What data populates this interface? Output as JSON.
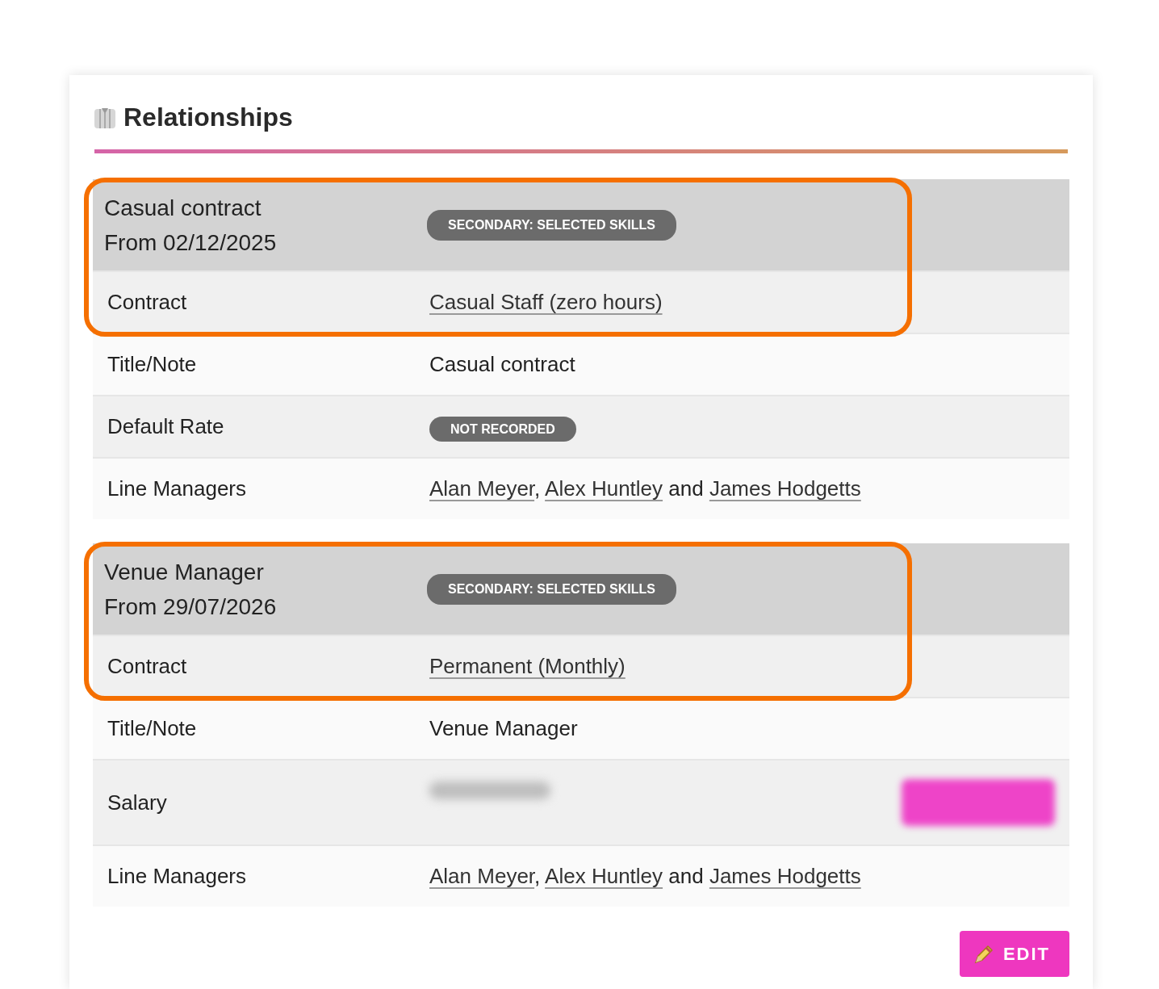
{
  "panel": {
    "title": "Relationships"
  },
  "relationships": [
    {
      "highlighted": true,
      "name": "Casual contract",
      "from": "From 02/12/2025",
      "badge": "SECONDARY: SELECTED SKILLS",
      "rows": [
        {
          "kind": "link",
          "label": "Contract",
          "value": "Casual Staff (zero hours)"
        },
        {
          "kind": "text",
          "label": "Title/Note",
          "value": "Casual contract"
        },
        {
          "kind": "badge",
          "label": "Default Rate",
          "value": "NOT RECORDED"
        },
        {
          "kind": "people",
          "label": "Line Managers",
          "managers": [
            "Alan Meyer",
            "Alex Huntley",
            "James Hodgetts"
          ],
          "separators": [
            ",",
            "and"
          ]
        }
      ]
    },
    {
      "highlighted": true,
      "name": "Venue Manager",
      "from": "From 29/07/2026",
      "badge": "SECONDARY: SELECTED SKILLS",
      "rows": [
        {
          "kind": "link",
          "label": "Contract",
          "value": "Permanent (Monthly)"
        },
        {
          "kind": "text",
          "label": "Title/Note",
          "value": "Venue Manager"
        },
        {
          "kind": "redacted",
          "label": "Salary"
        },
        {
          "kind": "people",
          "label": "Line Managers",
          "managers": [
            "Alan Meyer",
            "Alex Huntley",
            "James Hodgetts"
          ],
          "separators": [
            ",",
            "and"
          ]
        }
      ]
    }
  ],
  "edit_button": {
    "label": "EDIT"
  }
}
